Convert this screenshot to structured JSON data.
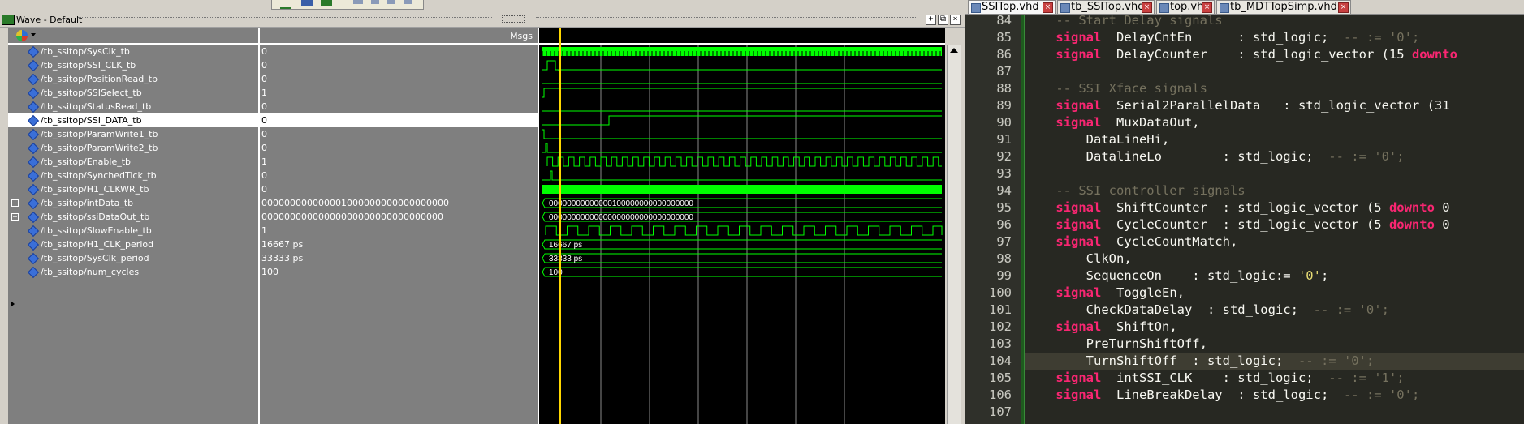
{
  "wave": {
    "title": "Wave - Default",
    "msgs_label": "Msgs",
    "signals": [
      {
        "name": "/tb_ssitop/SysClk_tb",
        "value": "0",
        "wave": "clock-fast"
      },
      {
        "name": "/tb_ssitop/SSI_CLK_tb",
        "value": "0",
        "wave": "pulse-early"
      },
      {
        "name": "/tb_ssitop/PositionRead_tb",
        "value": "0",
        "wave": "low"
      },
      {
        "name": "/tb_ssitop/SSISelect_tb",
        "value": "1",
        "wave": "high-after-start"
      },
      {
        "name": "/tb_ssitop/StatusRead_tb",
        "value": "0",
        "wave": "low"
      },
      {
        "name": "/tb_ssitop/SSI_DATA_tb",
        "value": "0",
        "wave": "step-high",
        "selected": true
      },
      {
        "name": "/tb_ssitop/ParamWrite1_tb",
        "value": "0",
        "wave": "pulse-start"
      },
      {
        "name": "/tb_ssitop/ParamWrite2_tb",
        "value": "0",
        "wave": "pulse-start2"
      },
      {
        "name": "/tb_ssitop/Enable_tb",
        "value": "1",
        "wave": "clock-slow"
      },
      {
        "name": "/tb_ssitop/SynchedTick_tb",
        "value": "0",
        "wave": "pulse-start3"
      },
      {
        "name": "/tb_ssitop/H1_CLKWR_tb",
        "value": "0",
        "wave": "solid"
      },
      {
        "name": "/tb_ssitop/intData_tb",
        "value": "000000000000001000000000000000000",
        "wave": "bus",
        "bus_text": "00000000000000100000000000000000",
        "expandable": true
      },
      {
        "name": "/tb_ssitop/ssiDataOut_tb",
        "value": "00000000000000000000000000000000",
        "wave": "bus",
        "bus_text": "00000000000000000000000000000000",
        "expandable": true
      },
      {
        "name": "/tb_ssitop/SlowEnable_tb",
        "value": "1",
        "wave": "clock-slower"
      },
      {
        "name": "/tb_ssitop/H1_CLK_period",
        "value": "16667 ps",
        "wave": "bus",
        "bus_text": "16667 ps"
      },
      {
        "name": "/tb_ssitop/SysClk_period",
        "value": "33333 ps",
        "wave": "bus",
        "bus_text": "33333 ps"
      },
      {
        "name": "/tb_ssitop/num_cycles",
        "value": "100",
        "wave": "bus",
        "bus_text": "100"
      }
    ],
    "cursor_color": "#ffd700",
    "signal_color": "#00ff00"
  },
  "editor": {
    "tabs": [
      {
        "label": "SSITop.vhd",
        "active": true
      },
      {
        "label": "tb_SSITop.vhd",
        "active": false
      },
      {
        "label": "top.vhd",
        "active": false
      },
      {
        "label": "tb_MDTTopSimp.vhd",
        "active": false
      }
    ],
    "lines": [
      {
        "num": "84",
        "segs": [
          [
            "c",
            "    -- Start Delay signals"
          ]
        ]
      },
      {
        "num": "85",
        "segs": [
          [
            "k",
            "    signal"
          ],
          [
            "t",
            "  DelayCntEn      : std_logic;  "
          ],
          [
            "c",
            "-- := '0';"
          ]
        ]
      },
      {
        "num": "86",
        "segs": [
          [
            "k",
            "    signal"
          ],
          [
            "t",
            "  DelayCounter    : std_logic_vector (15 "
          ],
          [
            "k",
            "downto"
          ]
        ]
      },
      {
        "num": "87",
        "segs": [
          [
            "t",
            ""
          ]
        ]
      },
      {
        "num": "88",
        "segs": [
          [
            "c",
            "    -- SSI Xface signals"
          ]
        ]
      },
      {
        "num": "89",
        "segs": [
          [
            "k",
            "    signal"
          ],
          [
            "t",
            "  Serial2ParallelData   : std_logic_vector (31"
          ]
        ]
      },
      {
        "num": "90",
        "segs": [
          [
            "k",
            "    signal"
          ],
          [
            "t",
            "  MuxDataOut,"
          ]
        ]
      },
      {
        "num": "91",
        "segs": [
          [
            "t",
            "        DataLineHi,"
          ]
        ]
      },
      {
        "num": "92",
        "segs": [
          [
            "t",
            "        DatalineLo        : std_logic;  "
          ],
          [
            "c",
            "-- := '0';"
          ]
        ]
      },
      {
        "num": "93",
        "segs": [
          [
            "t",
            ""
          ]
        ]
      },
      {
        "num": "94",
        "segs": [
          [
            "c",
            "    -- SSI controller signals"
          ]
        ]
      },
      {
        "num": "95",
        "segs": [
          [
            "k",
            "    signal"
          ],
          [
            "t",
            "  ShiftCounter  : std_logic_vector (5 "
          ],
          [
            "k",
            "downto"
          ],
          [
            "t",
            " 0"
          ]
        ]
      },
      {
        "num": "96",
        "segs": [
          [
            "k",
            "    signal"
          ],
          [
            "t",
            "  CycleCounter  : std_logic_vector (5 "
          ],
          [
            "k",
            "downto"
          ],
          [
            "t",
            " 0"
          ]
        ]
      },
      {
        "num": "97",
        "segs": [
          [
            "k",
            "    signal"
          ],
          [
            "t",
            "  CycleCountMatch,"
          ]
        ]
      },
      {
        "num": "98",
        "segs": [
          [
            "t",
            "        ClkOn,"
          ]
        ]
      },
      {
        "num": "99",
        "segs": [
          [
            "t",
            "        SequenceOn    : std_logic:= "
          ],
          [
            "s",
            "'0'"
          ],
          [
            "t",
            ";"
          ]
        ]
      },
      {
        "num": "100",
        "segs": [
          [
            "k",
            "    signal"
          ],
          [
            "t",
            "  ToggleEn,"
          ]
        ]
      },
      {
        "num": "101",
        "segs": [
          [
            "t",
            "        CheckDataDelay  : std_logic;  "
          ],
          [
            "c",
            "-- := '0';"
          ]
        ]
      },
      {
        "num": "102",
        "segs": [
          [
            "k",
            "    signal"
          ],
          [
            "t",
            "  ShiftOn,"
          ]
        ]
      },
      {
        "num": "103",
        "segs": [
          [
            "t",
            "        PreTurnShiftOff,"
          ]
        ]
      },
      {
        "num": "104",
        "segs": [
          [
            "t",
            "        TurnShiftOff  : std_logic;  "
          ],
          [
            "c",
            "-- := '0';"
          ]
        ],
        "current": true
      },
      {
        "num": "105",
        "segs": [
          [
            "k",
            "    signal"
          ],
          [
            "t",
            "  intSSI_CLK    : std_logic;  "
          ],
          [
            "c",
            "-- := '1';"
          ]
        ]
      },
      {
        "num": "106",
        "segs": [
          [
            "k",
            "    signal"
          ],
          [
            "t",
            "  LineBreakDelay  : std_logic;  "
          ],
          [
            "c",
            "-- := '0';"
          ]
        ]
      },
      {
        "num": "107",
        "segs": [
          [
            "t",
            ""
          ]
        ]
      }
    ]
  }
}
